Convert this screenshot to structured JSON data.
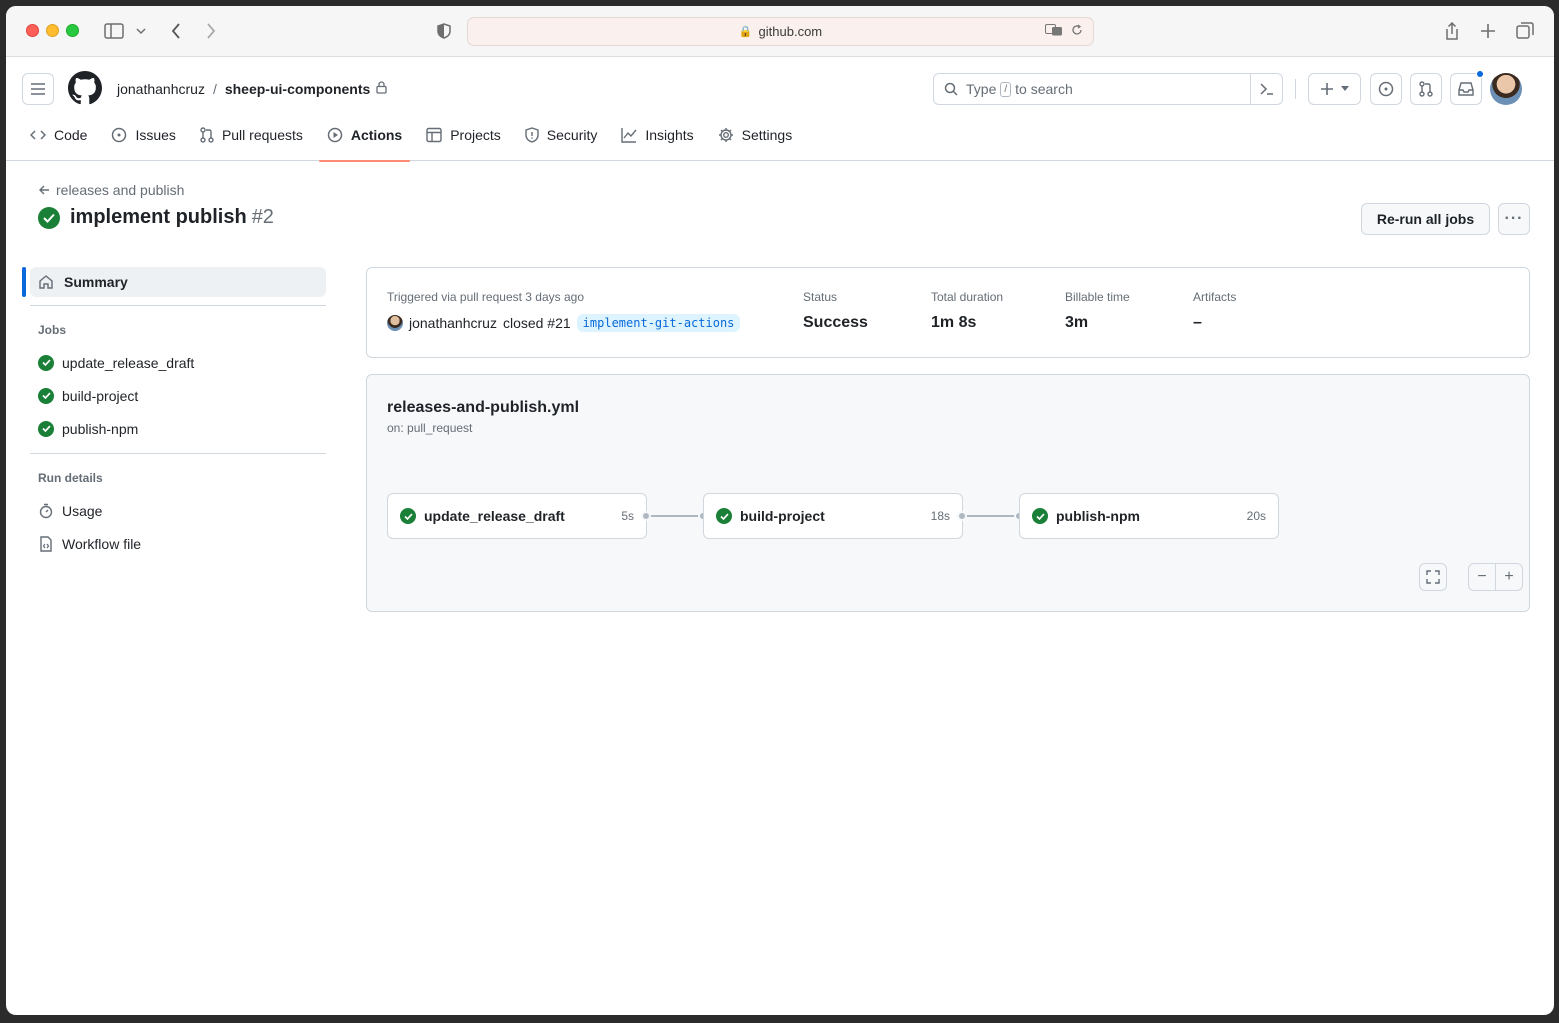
{
  "browser": {
    "url": "github.com"
  },
  "header": {
    "owner": "jonathanhcruz",
    "separator": "/",
    "repo": "sheep-ui-components",
    "search_prefix": "Type",
    "search_key": "/",
    "search_suffix": "to search"
  },
  "nav": {
    "tabs": [
      {
        "label": "Code",
        "icon": "code-icon"
      },
      {
        "label": "Issues",
        "icon": "issue-icon"
      },
      {
        "label": "Pull requests",
        "icon": "pull-request-icon"
      },
      {
        "label": "Actions",
        "icon": "play-icon",
        "active": true
      },
      {
        "label": "Projects",
        "icon": "table-icon"
      },
      {
        "label": "Security",
        "icon": "shield-icon"
      },
      {
        "label": "Insights",
        "icon": "graph-icon"
      },
      {
        "label": "Settings",
        "icon": "gear-icon"
      }
    ]
  },
  "run": {
    "back_label": "releases and publish",
    "title": "implement publish",
    "number": "#2",
    "rerun_label": "Re-run all jobs",
    "more_label": "···"
  },
  "sidebar": {
    "summary_label": "Summary",
    "jobs_heading": "Jobs",
    "jobs": [
      "update_release_draft",
      "build-project",
      "publish-npm"
    ],
    "details_heading": "Run details",
    "usage_label": "Usage",
    "workflow_file_label": "Workflow file"
  },
  "summary": {
    "triggered_label": "Triggered via pull request 3 days ago",
    "actor": "jonathanhcruz",
    "action": "closed #21",
    "branch": "implement-git-actions",
    "status_label": "Status",
    "status_value": "Success",
    "duration_label": "Total duration",
    "duration_value": "1m 8s",
    "billable_label": "Billable time",
    "billable_value": "3m",
    "artifacts_label": "Artifacts",
    "artifacts_value": "–"
  },
  "graph": {
    "workflow_file": "releases-and-publish.yml",
    "trigger": "on: pull_request",
    "jobs": [
      {
        "name": "update_release_draft",
        "duration": "5s"
      },
      {
        "name": "build-project",
        "duration": "18s"
      },
      {
        "name": "publish-npm",
        "duration": "20s"
      }
    ],
    "minus_label": "−",
    "plus_label": "+"
  },
  "colors": {
    "success": "#1a7f37",
    "accent": "#0969da",
    "active_tab_underline": "#fd8c73"
  }
}
